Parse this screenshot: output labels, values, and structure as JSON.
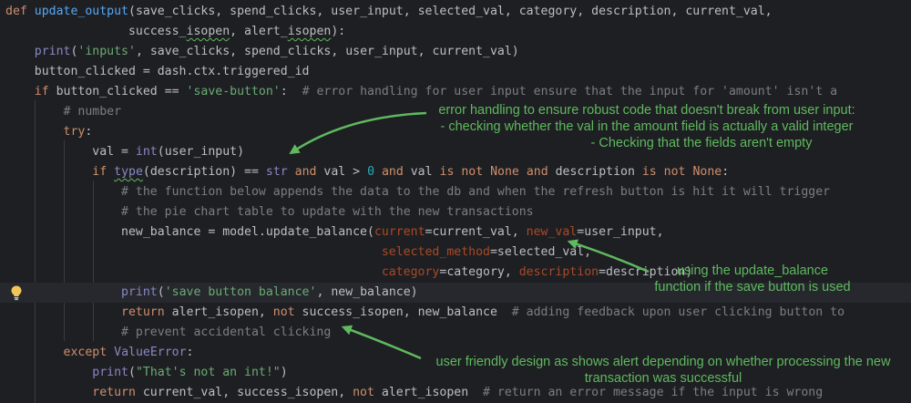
{
  "code": {
    "l1": {
      "kw_def": "def",
      "fn_name": "update_output",
      "params": "(save_clicks, spend_clicks, user_input, selected_val, category, description, current_val,"
    },
    "l2": {
      "indent": "                 ",
      "p1": "success_",
      "p1_sq": "isopen",
      "p2": ", alert_",
      "p2_sq": "isopen",
      "end": "):"
    },
    "l3": {
      "indent": "    ",
      "print": "print",
      "open": "(",
      "str": "'inputs'",
      "rest": ", save_clicks, spend_clicks, user_input, current_val)"
    },
    "l4": {
      "text": "    button_clicked = dash.ctx.triggered_id"
    },
    "l5": {
      "indent": "    ",
      "kw_if": "if",
      "mid": " button_clicked == ",
      "str": "'save-button'",
      "colon": ":  ",
      "comment": "# error handling for user input ensure that the input for 'amount' isn't a"
    },
    "l6": {
      "indent": "        ",
      "comment": "# number"
    },
    "l7": {
      "indent": "        ",
      "kw_try": "try",
      "colon": ":"
    },
    "l8": {
      "indent": "            ",
      "pre": "val = ",
      "int": "int",
      "post": "(user_input)"
    },
    "l9": {
      "indent": "            ",
      "kw_if": "if",
      "sp": " ",
      "type_sq": "type",
      "mid1": "(description) == ",
      "str_t": "str",
      "sp2": " ",
      "kw_and1": "and",
      "mid2": " val > ",
      "num0": "0",
      "sp3": " ",
      "kw_and2": "and",
      "mid3": " val ",
      "kw_isnot1": "is not",
      "sp4": " ",
      "kw_none1": "None",
      "sp5": " ",
      "kw_and3": "and",
      "mid4": " description ",
      "kw_isnot2": "is not",
      "sp6": " ",
      "kw_none2": "None",
      "end": ":"
    },
    "l10": {
      "indent": "                ",
      "comment": "# the function below appends the data to the db and when the refresh button is hit it will trigger"
    },
    "l11": {
      "indent": "                ",
      "comment": "# the pie chart table to update with the new transactions"
    },
    "l12": {
      "indent": "                ",
      "pre": "new_balance = model.update_balance(",
      "param1": "current",
      "mid": "=current_val, ",
      "param2": "new_val",
      "post": "=user_input,"
    },
    "l13": {
      "indent": "                                                    ",
      "param": "selected_method",
      "post": "=selected_val,"
    },
    "l14": {
      "indent": "                                                    ",
      "param1": "category",
      "mid": "=category, ",
      "param2": "description",
      "post": "=description)"
    },
    "l15": {
      "indent": "                ",
      "print": "print",
      "open": "(",
      "str": "'save button balance'",
      "post": ", new_balance)"
    },
    "l16": {
      "indent": "                ",
      "kw_return": "return",
      "mid": " alert_isopen, ",
      "kw_not": "not",
      "post": " success_isopen, new_balance  ",
      "comment": "# adding feedback upon user clicking button to"
    },
    "l17": {
      "indent": "                ",
      "comment": "# prevent accidental clicking"
    },
    "l18": {
      "indent": "        ",
      "kw_except": "except",
      "sp": " ",
      "exc": "ValueError",
      "colon": ":"
    },
    "l19": {
      "indent": "            ",
      "print": "print",
      "open": "(",
      "str": "\"That's not an int!\"",
      "close": ")"
    },
    "l20": {
      "indent": "            ",
      "kw_return": "return",
      "mid": " current_val, success_isopen, ",
      "kw_not": "not",
      "post": " alert_isopen  ",
      "comment": "# return an error message if the input is wrong"
    }
  },
  "annotations": {
    "error_handling": [
      "error handling to ensure robust code that doesn't break from user input:",
      "- checking whether the val in the amount field is actually a valid integer",
      "- Checking that the fields aren't empty"
    ],
    "update_balance": [
      "using the update_balance",
      "function if the save button is used"
    ],
    "user_friendly": [
      "user friendly design as shows alert depending on whether processing the new",
      "transaction was successful"
    ]
  },
  "colors": {
    "background": "#1e1f22",
    "keyword": "#cf8e6d",
    "function": "#56a8f5",
    "string": "#6aab73",
    "comment": "#7a7e85",
    "number": "#2aacb8",
    "named_param": "#aa4926",
    "annotation": "#5fb95f"
  },
  "icons": {
    "gutter": "lightbulb-icon"
  }
}
